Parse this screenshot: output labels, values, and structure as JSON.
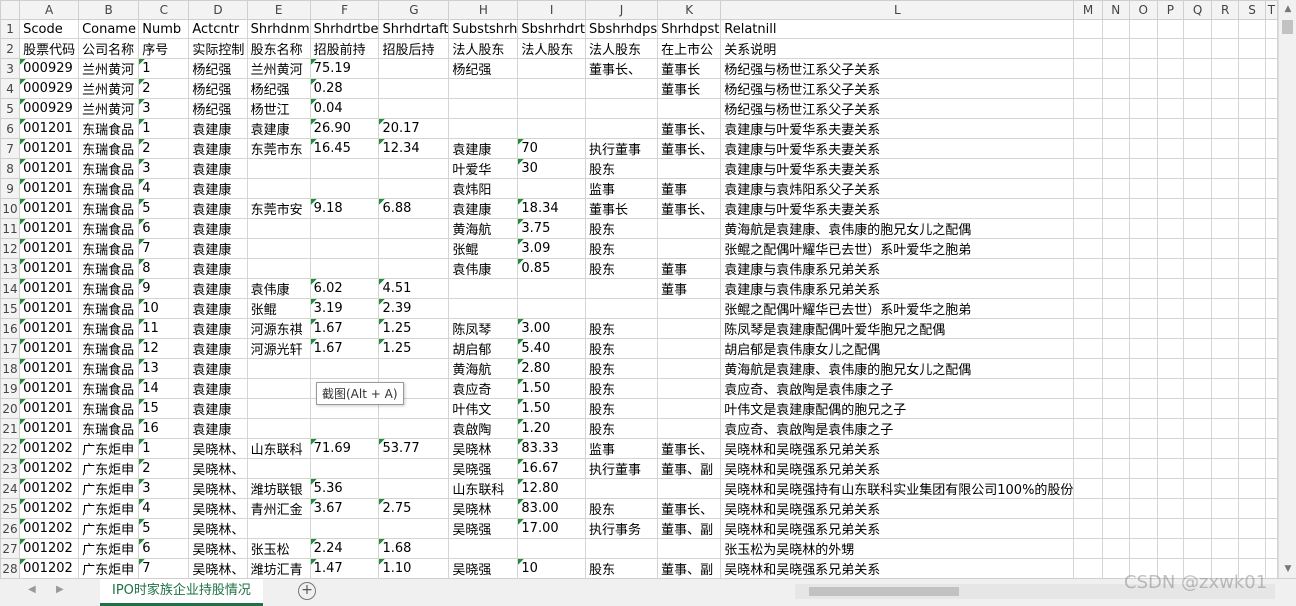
{
  "column_letters": [
    "A",
    "B",
    "C",
    "D",
    "E",
    "F",
    "G",
    "H",
    "I",
    "J",
    "K",
    "L",
    "M",
    "N",
    "O",
    "P",
    "Q",
    "R",
    "S",
    "T"
  ],
  "rows": [
    {
      "n": "1",
      "cells": [
        "Scode",
        "Coname",
        "Numb",
        "Actcntr",
        "Shrhdnm",
        "Shrhdrtbe",
        "Shrhdrtaft",
        "Substshrh",
        "Sbshrhdrt",
        "Sbshrhdps",
        "Shrhdpst",
        "Relatnill"
      ]
    },
    {
      "n": "2",
      "cells": [
        "股票代码",
        "公司名称",
        "序号",
        "实际控制",
        "股东名称",
        "招股前持",
        "招股后持",
        "法人股东",
        "法人股东",
        "法人股东",
        "在上市公",
        "关系说明"
      ]
    },
    {
      "n": "3",
      "cells": [
        "000929",
        "兰州黄河",
        "1",
        "杨纪强",
        "兰州黄河",
        "75.19",
        "",
        "杨纪强",
        "",
        "董事长、",
        "董事长",
        "杨纪强与杨世江系父子关系"
      ]
    },
    {
      "n": "4",
      "cells": [
        "000929",
        "兰州黄河",
        "2",
        "杨纪强",
        "杨纪强",
        "0.28",
        "",
        "",
        "",
        "",
        "董事长",
        "杨纪强与杨世江系父子关系"
      ]
    },
    {
      "n": "5",
      "cells": [
        "000929",
        "兰州黄河",
        "3",
        "杨纪强",
        "杨世江",
        "0.04",
        "",
        "",
        "",
        "",
        "",
        "杨纪强与杨世江系父子关系"
      ]
    },
    {
      "n": "6",
      "cells": [
        "001201",
        "东瑞食品",
        "1",
        "袁建康",
        "袁建康",
        "26.90",
        "20.17",
        "",
        "",
        "",
        "董事长、",
        "袁建康与叶爱华系夫妻关系"
      ]
    },
    {
      "n": "7",
      "cells": [
        "001201",
        "东瑞食品",
        "2",
        "袁建康",
        "东莞市东",
        "16.45",
        "12.34",
        "袁建康",
        "70",
        "执行董事",
        "董事长、",
        "袁建康与叶爱华系夫妻关系"
      ]
    },
    {
      "n": "8",
      "cells": [
        "001201",
        "东瑞食品",
        "3",
        "袁建康",
        "",
        "",
        "",
        "叶爱华",
        "30",
        "股东",
        "",
        "袁建康与叶爱华系夫妻关系"
      ]
    },
    {
      "n": "9",
      "cells": [
        "001201",
        "东瑞食品",
        "4",
        "袁建康",
        "",
        "",
        "",
        "袁炜阳",
        "",
        "监事",
        "董事",
        "袁建康与袁炜阳系父子关系"
      ]
    },
    {
      "n": "10",
      "cells": [
        "001201",
        "东瑞食品",
        "5",
        "袁建康",
        "东莞市安",
        "9.18",
        "6.88",
        "袁建康",
        "18.34",
        "董事长",
        "董事长、",
        "袁建康与叶爱华系夫妻关系"
      ]
    },
    {
      "n": "11",
      "cells": [
        "001201",
        "东瑞食品",
        "6",
        "袁建康",
        "",
        "",
        "",
        "黄海航",
        "3.75",
        "股东",
        "",
        "黄海航是袁建康、袁伟康的胞兄女儿之配偶"
      ]
    },
    {
      "n": "12",
      "cells": [
        "001201",
        "东瑞食品",
        "7",
        "袁建康",
        "",
        "",
        "",
        "张鲲",
        "3.09",
        "股东",
        "",
        "张鲲之配偶叶耀华已去世）系叶爱华之胞弟"
      ]
    },
    {
      "n": "13",
      "cells": [
        "001201",
        "东瑞食品",
        "8",
        "袁建康",
        "",
        "",
        "",
        "袁伟康",
        "0.85",
        "股东",
        "董事",
        "袁建康与袁伟康系兄弟关系"
      ]
    },
    {
      "n": "14",
      "cells": [
        "001201",
        "东瑞食品",
        "9",
        "袁建康",
        "袁伟康",
        "6.02",
        "4.51",
        "",
        "",
        "",
        "董事",
        "袁建康与袁伟康系兄弟关系"
      ]
    },
    {
      "n": "15",
      "cells": [
        "001201",
        "东瑞食品",
        "10",
        "袁建康",
        "张鲲",
        "3.19",
        "2.39",
        "",
        "",
        "",
        "",
        "张鲲之配偶叶耀华已去世）系叶爱华之胞弟"
      ]
    },
    {
      "n": "16",
      "cells": [
        "001201",
        "东瑞食品",
        "11",
        "袁建康",
        "河源东祺",
        "1.67",
        "1.25",
        "陈凤琴",
        "3.00",
        "股东",
        "",
        "陈凤琴是袁建康配偶叶爱华胞兄之配偶"
      ]
    },
    {
      "n": "17",
      "cells": [
        "001201",
        "东瑞食品",
        "12",
        "袁建康",
        "河源光轩",
        "1.67",
        "1.25",
        "胡启郁",
        "5.40",
        "股东",
        "",
        "胡启郁是袁伟康女儿之配偶"
      ]
    },
    {
      "n": "18",
      "cells": [
        "001201",
        "东瑞食品",
        "13",
        "袁建康",
        "",
        "",
        "",
        "黄海航",
        "2.80",
        "股东",
        "",
        "黄海航是袁建康、袁伟康的胞兄女儿之配偶"
      ]
    },
    {
      "n": "19",
      "cells": [
        "001201",
        "东瑞食品",
        "14",
        "袁建康",
        "",
        "",
        "",
        "袁应奇",
        "1.50",
        "股东",
        "",
        "袁应奇、袁啟陶是袁伟康之子"
      ]
    },
    {
      "n": "20",
      "cells": [
        "001201",
        "东瑞食品",
        "15",
        "袁建康",
        "",
        "",
        "",
        "叶伟文",
        "1.50",
        "股东",
        "",
        "叶伟文是袁建康配偶的胞兄之子"
      ]
    },
    {
      "n": "21",
      "cells": [
        "001201",
        "东瑞食品",
        "16",
        "袁建康",
        "",
        "",
        "",
        "袁啟陶",
        "1.20",
        "股东",
        "",
        "袁应奇、袁啟陶是袁伟康之子"
      ]
    },
    {
      "n": "22",
      "cells": [
        "001202",
        "广东炬申",
        "1",
        "吴晓林、",
        "山东联科",
        "71.69",
        "53.77",
        "吴晓林",
        "83.33",
        "监事",
        "董事长、",
        "吴晓林和吴晓强系兄弟关系"
      ]
    },
    {
      "n": "23",
      "cells": [
        "001202",
        "广东炬申",
        "2",
        "吴晓林、",
        "",
        "",
        "",
        "吴晓强",
        "16.67",
        "执行董事",
        "董事、副",
        "吴晓林和吴晓强系兄弟关系"
      ]
    },
    {
      "n": "24",
      "cells": [
        "001202",
        "广东炬申",
        "3",
        "吴晓林、",
        "潍坊联银",
        "5.36",
        "",
        "山东联科",
        "12.80",
        "",
        "",
        "吴晓林和吴晓强持有山东联科实业集团有限公司100%的股份"
      ]
    },
    {
      "n": "25",
      "cells": [
        "001202",
        "广东炬申",
        "4",
        "吴晓林、",
        "青州汇金",
        "3.67",
        "2.75",
        "吴晓林",
        "83.00",
        "股东",
        "董事长、",
        "吴晓林和吴晓强系兄弟关系"
      ]
    },
    {
      "n": "26",
      "cells": [
        "001202",
        "广东炬申",
        "5",
        "吴晓林、",
        "",
        "",
        "",
        "吴晓强",
        "17.00",
        "执行事务",
        "董事、副",
        "吴晓林和吴晓强系兄弟关系"
      ]
    },
    {
      "n": "27",
      "cells": [
        "001202",
        "广东炬申",
        "6",
        "吴晓林、",
        "张玉松",
        "2.24",
        "1.68",
        "",
        "",
        "",
        "",
        "张玉松为吴晓林的外甥"
      ]
    },
    {
      "n": "28",
      "cells": [
        "001202",
        "广东炬申",
        "7",
        "吴晓林、",
        "潍坊汇青",
        "1.47",
        "1.10",
        "吴晓强",
        "10",
        "股东",
        "董事、副",
        "吴晓林和吴晓强系兄弟关系"
      ]
    }
  ],
  "sheet_tab": "IPO时家族企业持股情况",
  "add_sheet_symbol": "+",
  "tooltip": "截图(Alt + A)",
  "watermark": "CSDN @zxwk01",
  "nav": {
    "prev": "◀",
    "next": "▶",
    "up": "▲",
    "down": "▼"
  }
}
